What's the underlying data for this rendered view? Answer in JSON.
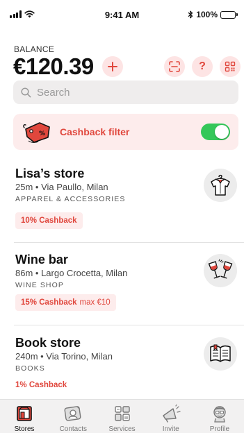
{
  "status_bar": {
    "time": "9:41 AM",
    "battery_text": "100%",
    "battery_level": 1.0
  },
  "balance": {
    "label": "BALANCE",
    "amount": "€120.39"
  },
  "header_actions": {
    "add_icon": "plus-icon",
    "scan_icon": "scan-icon",
    "help_icon": "question-icon",
    "help_glyph": "?",
    "qr_icon": "qr-code-icon"
  },
  "search": {
    "placeholder": "Search",
    "value": ""
  },
  "cashback_filter": {
    "label": "Cashback filter",
    "enabled": true
  },
  "stores": [
    {
      "name": "Lisa’s store",
      "address": "25m • Via Paullo, Milan",
      "category": "APPAREL & ACCESSORIES",
      "cashback": "10% Cashback",
      "cashback_extra": "",
      "icon": "shirt-icon"
    },
    {
      "name": "Wine bar",
      "address": "86m • Largo Crocetta, Milan",
      "category": "WINE SHOP",
      "cashback": "15% Cashback",
      "cashback_extra": "max €10",
      "icon": "wine-glasses-icon"
    },
    {
      "name": "Book store",
      "address": "240m • Via Torino, Milan",
      "category": "BOOKS",
      "cashback": "1% Cashback",
      "cashback_extra": "",
      "icon": "book-icon"
    }
  ],
  "tabs": [
    {
      "label": "Stores",
      "icon": "store-icon",
      "active": true
    },
    {
      "label": "Contacts",
      "icon": "contacts-icon",
      "active": false
    },
    {
      "label": "Services",
      "icon": "services-icon",
      "active": false
    },
    {
      "label": "Invite",
      "icon": "megaphone-icon",
      "active": false
    },
    {
      "label": "Profile",
      "icon": "profile-icon",
      "active": false
    }
  ],
  "colors": {
    "accent": "#e0473d",
    "accent_soft": "#fdecec",
    "toggle_on": "#34c759"
  }
}
